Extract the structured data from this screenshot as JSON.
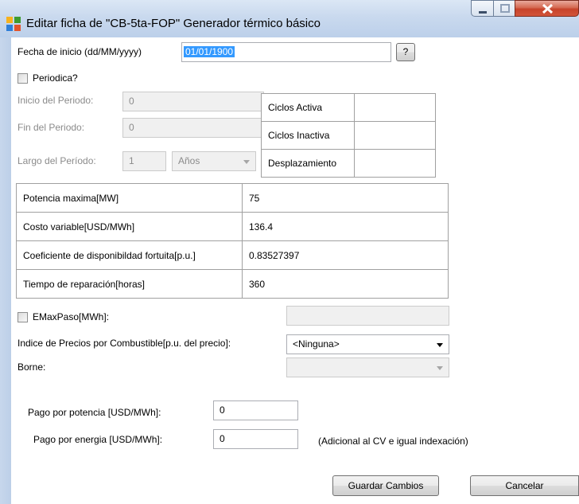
{
  "window": {
    "title": "Editar ficha de  \"CB-5ta-FOP\" Generador térmico básico",
    "icon": "app-grid-icon",
    "controls": [
      "minimize-icon",
      "maximize-icon",
      "close-icon"
    ]
  },
  "fecha": {
    "label": "Fecha de inicio (dd/MM/yyyy)",
    "value": "01/01/1900",
    "help_label": "?"
  },
  "periodica": {
    "label": "Periodica?",
    "checked": false
  },
  "periodo": {
    "inicio_label": "Inicio del Periodo:",
    "inicio_value": "0",
    "fin_label": "Fin del Periodo:",
    "fin_value": "0",
    "largo_label": "Largo del Período:",
    "largo_value": "1",
    "unidad_value": "Años"
  },
  "ciclos": [
    {
      "label": "Ciclos Activa",
      "value": ""
    },
    {
      "label": "Ciclos Inactiva",
      "value": ""
    },
    {
      "label": "Desplazamiento",
      "value": ""
    }
  ],
  "params": [
    {
      "label": "Potencia maxima[MW]",
      "value": "75"
    },
    {
      "label": "Costo variable[USD/MWh]",
      "value": "136.4"
    },
    {
      "label": "Coeficiente de disponibildad fortuita[p.u.]",
      "value": "0.83527397"
    },
    {
      "label": "Tiempo de reparación[horas]",
      "value": "360"
    }
  ],
  "emaxpaso": {
    "label": "EMaxPaso[MWh]:",
    "checked": false,
    "value": ""
  },
  "indice": {
    "label": "Indice de Precios por Combustible[p.u. del precio]:",
    "value": "<Ninguna>"
  },
  "borne": {
    "label": "Borne:",
    "value": ""
  },
  "pago_potencia": {
    "label": "Pago por potencia [USD/MWh]:",
    "value": "0"
  },
  "pago_energia": {
    "label": "Pago por energia  [USD/MWh]:",
    "value": "0",
    "note": "(Adicional al CV e igual indexación)"
  },
  "buttons": {
    "save_label": "Guardar Cambios",
    "cancel_label": "Cancelar"
  },
  "colors": {
    "selection": "#3399ff",
    "titlebar": "#c9d9ee",
    "close": "#c7432a"
  }
}
